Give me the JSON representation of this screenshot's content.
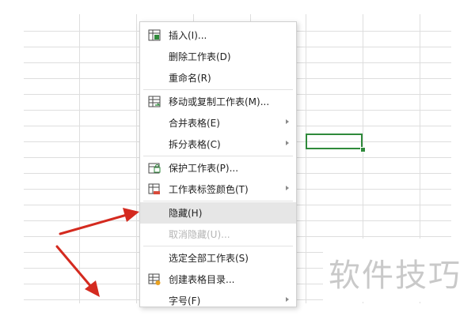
{
  "context_menu": {
    "items": [
      {
        "id": "insert",
        "label": "插入(I)...",
        "icon": "insert-sheet-icon",
        "submenu": false,
        "disabled": false,
        "highlighted": false
      },
      {
        "id": "delete-sheet",
        "label": "删除工作表(D)",
        "icon": "",
        "submenu": false,
        "disabled": false,
        "highlighted": false
      },
      {
        "id": "rename",
        "label": "重命名(R)",
        "icon": "",
        "submenu": false,
        "disabled": false,
        "highlighted": false
      },
      {
        "id": "move-copy",
        "label": "移动或复制工作表(M)...",
        "icon": "move-copy-sheet-icon",
        "submenu": false,
        "disabled": false,
        "highlighted": false
      },
      {
        "id": "merge",
        "label": "合并表格(E)",
        "icon": "",
        "submenu": true,
        "disabled": false,
        "highlighted": false
      },
      {
        "id": "split",
        "label": "拆分表格(C)",
        "icon": "",
        "submenu": true,
        "disabled": false,
        "highlighted": false
      },
      {
        "id": "protect",
        "label": "保护工作表(P)...",
        "icon": "protect-sheet-icon",
        "submenu": false,
        "disabled": false,
        "highlighted": false
      },
      {
        "id": "tab-color",
        "label": "工作表标签颜色(T)",
        "icon": "tab-color-icon",
        "submenu": true,
        "disabled": false,
        "highlighted": false
      },
      {
        "id": "hide",
        "label": "隐藏(H)",
        "icon": "",
        "submenu": false,
        "disabled": false,
        "highlighted": true
      },
      {
        "id": "unhide",
        "label": "取消隐藏(U)...",
        "icon": "",
        "submenu": false,
        "disabled": true,
        "highlighted": false
      },
      {
        "id": "select-all",
        "label": "选定全部工作表(S)",
        "icon": "",
        "submenu": false,
        "disabled": false,
        "highlighted": false
      },
      {
        "id": "create-toc",
        "label": "创建表格目录...",
        "icon": "table-catalog-icon",
        "submenu": false,
        "disabled": false,
        "highlighted": false
      },
      {
        "id": "font-size",
        "label": "字号(F)",
        "icon": "",
        "submenu": true,
        "disabled": false,
        "highlighted": false
      }
    ]
  },
  "watermark": {
    "text": "软件技巧"
  },
  "colors": {
    "selection_border": "#2f8a3b",
    "annotation_arrow": "#d42a1f",
    "menu_hover": "#e6e6e6",
    "disabled_text": "#b5b5b5"
  }
}
